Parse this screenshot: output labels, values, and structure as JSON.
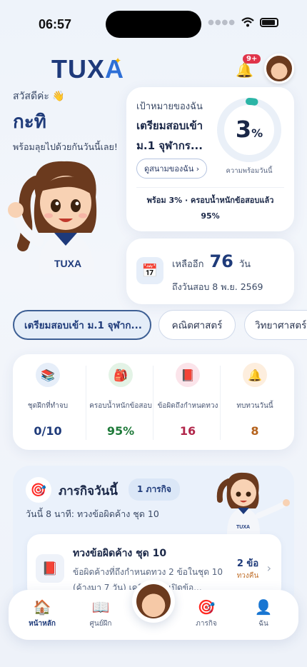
{
  "status_bar": {
    "time": "06:57"
  },
  "brand": {
    "logo_main": "TUX",
    "logo_accent": "A"
  },
  "header": {
    "notification_badge": "9+"
  },
  "greeting": {
    "hello": "สวัสดีค่ะ 👋",
    "name": "กะทิ",
    "subtitle": "พร้อมลุยไปด้วยกันวันนี้เลย!"
  },
  "goal": {
    "label": "เป้าหมายของฉัน",
    "title": "เตรียมสอบเข้า ม.1 จุฬากร...",
    "button": "ดูสนามของฉัน ›",
    "readiness_percent": 3,
    "readiness_value": "3",
    "readiness_unit": "%",
    "readiness_label": "ความพร้อมวันนี้",
    "summary": "พร้อม 3% · ครอบน้ำหนักข้อสอบแล้ว 95%"
  },
  "countdown": {
    "prefix": "เหลืออีก",
    "days": "76",
    "unit": "วัน",
    "until": "ถึงวันสอบ 8 พ.ย. 2569"
  },
  "chips": [
    {
      "label": "เตรียมสอบเข้า ม.1 จุฬาก...",
      "active": true
    },
    {
      "label": "คณิตศาสตร์",
      "active": false
    },
    {
      "label": "วิทยาศาสตร์",
      "active": false
    }
  ],
  "stats": [
    {
      "label": "ชุดฝึกที่ทำจบ",
      "value": "0/10",
      "icon": "books-icon",
      "color": "#1f3b7a",
      "bg": "#e6eef9"
    },
    {
      "label": "ครอบน้ำหนักข้อสอบ",
      "value": "95%",
      "icon": "backpack-icon",
      "color": "#1f7a3a",
      "bg": "#e3f3e6"
    },
    {
      "label": "ข้อผิดถึงกำหนดทวง",
      "value": "16",
      "icon": "book-red-icon",
      "color": "#b1264a",
      "bg": "#fbe4ea"
    },
    {
      "label": "ทบทวนวันนี้",
      "value": "8",
      "icon": "bell-icon",
      "color": "#b5621c",
      "bg": "#fdeede"
    }
  ],
  "mission": {
    "title": "ภารกิจวันนี้",
    "count": "1 ภารกิจ",
    "subtitle": "วันนี้ 8 นาที: ทวงข้อผิดค้าง ชุด 10",
    "task": {
      "title": "ทวงข้อผิดค้าง ชุด 10",
      "desc": "ข้อผิดค้างที่ถึงกำหนดทวง 2 ข้อในชุด 10 (ค้างมา 7 วัน) เคลียร์ก่อนเปิดข้อ...",
      "count": "2 ข้อ",
      "status": "ทวงคืน"
    }
  },
  "nav": [
    {
      "label": "หน้าหลัก",
      "icon": "home-icon",
      "active": true
    },
    {
      "label": "ศูนย์ฝึก",
      "icon": "book-open-icon",
      "active": false
    },
    {
      "label": "ภารกิจ",
      "icon": "target-icon",
      "active": false
    },
    {
      "label": "ฉัน",
      "icon": "user-icon",
      "active": false
    }
  ]
}
